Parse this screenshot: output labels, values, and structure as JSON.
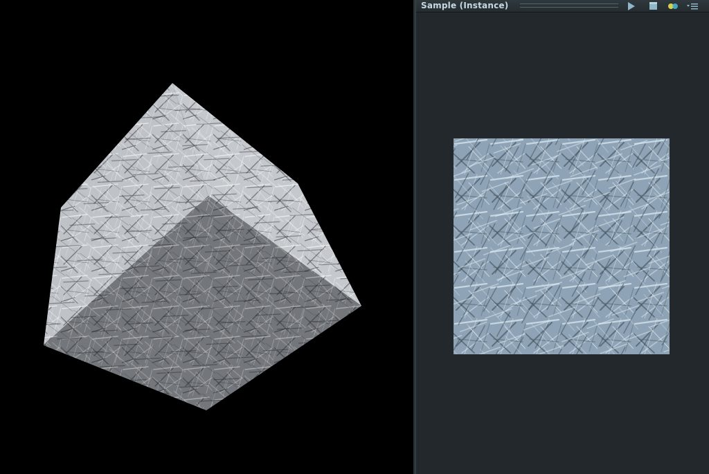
{
  "panel": {
    "title": "Sample (Instance)",
    "buttons": {
      "play": "play-icon",
      "stop": "stop-icon",
      "channels": "channels-icon",
      "menu": "menu-icon"
    }
  },
  "colors": {
    "viewport_bg": "#000000",
    "panel_bg": "#22282c",
    "title_text": "#c6d9e2",
    "texture_tint": "#8ea4b6",
    "cube_light": "#c9ccd0",
    "cube_mid": "#a2a6ab",
    "cube_dark": "#6c7075"
  }
}
